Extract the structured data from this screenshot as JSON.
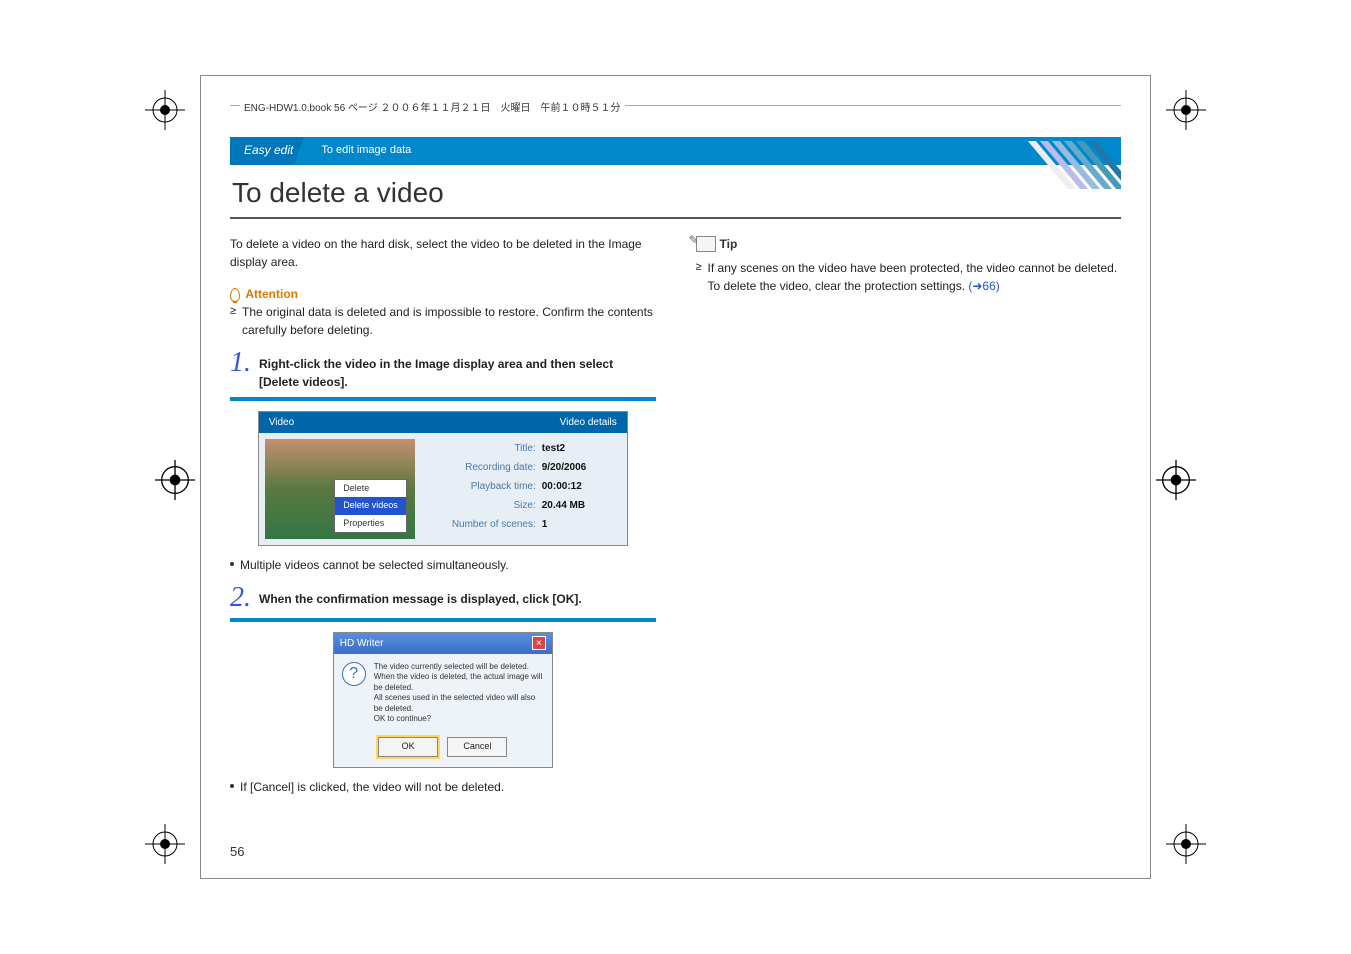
{
  "header_text": "ENG-HDW1.0.book  56 ページ  ２００６年１１月２１日　火曜日　午前１０時５１分",
  "titlebar": {
    "section": "Easy edit",
    "subsection": "To edit image data"
  },
  "main_title": "To delete a video",
  "intro": "To delete a video on the hard disk, select the video to be deleted in the Image display area.",
  "attention": {
    "label": "Attention",
    "text": "The original data is deleted and is impossible to restore. Confirm the contents carefully before deleting."
  },
  "steps": {
    "1": {
      "num": "1.",
      "label": "Right-click the video in the Image display area and then select [Delete videos].",
      "note": "Multiple videos cannot be selected simultaneously."
    },
    "2": {
      "num": "2.",
      "label": "When the confirmation message is displayed, click [OK].",
      "note": "If [Cancel] is clicked, the video will not be deleted."
    }
  },
  "screenshot1": {
    "tab_left": "Video",
    "tab_right": "Video details",
    "context_menu": {
      "item1": "Delete",
      "item2": "Delete videos",
      "item3": "Properties"
    },
    "details": {
      "title_label": "Title:",
      "title_val": "test2",
      "date_label": "Recording date:",
      "date_val": "9/20/2006",
      "time_label": "Playback time:",
      "time_val": "00:00:12",
      "size_label": "Size:",
      "size_val": "20.44 MB",
      "scenes_label": "Number of scenes:",
      "scenes_val": "1"
    }
  },
  "screenshot2": {
    "title": "HD Writer",
    "msg": "The video currently selected will be deleted.\nWhen the video is deleted, the actual image will be deleted.\nAll scenes used in the selected video will also be deleted.\nOK to continue?",
    "ok": "OK",
    "cancel": "Cancel"
  },
  "tip": {
    "label": "Tip",
    "text": "If any scenes on the video have been protected, the video cannot be deleted. To delete the video, clear the protection settings. ",
    "link": "(➜66)"
  },
  "page_num": "56"
}
